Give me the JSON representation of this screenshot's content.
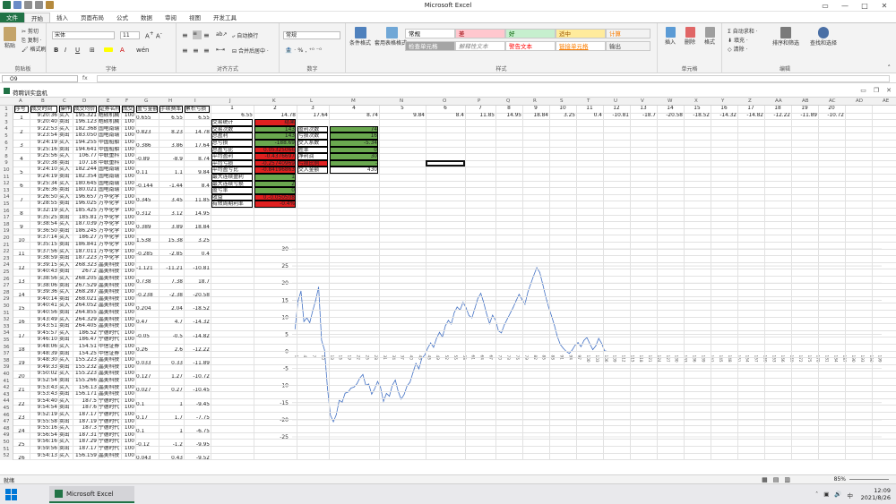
{
  "app": {
    "title": "Microsoft Excel",
    "workbook_title": "荷聘训实盘机"
  },
  "tabs": [
    "文件",
    "开始",
    "插入",
    "页面布局",
    "公式",
    "数据",
    "审阅",
    "视图",
    "开发工具"
  ],
  "ribbon": {
    "clipboard": {
      "group": "剪贴板",
      "paste": "粘贴",
      "cut": "剪切",
      "copy": "复制 ·",
      "format_painter": "格式刷"
    },
    "font": {
      "group": "字体",
      "font_name": "宋体",
      "font_size": "11"
    },
    "alignment": {
      "group": "对齐方式",
      "wrap": "自动换行",
      "merge": "合并后居中 ·"
    },
    "number": {
      "group": "数字",
      "format": "常规"
    },
    "styles": {
      "group": "样式",
      "conditional": "条件格式",
      "table": "套用表格格式 ·",
      "cells": [
        {
          "label": "常规",
          "bg": "#ffffff",
          "fg": "#000000"
        },
        {
          "label": "差",
          "bg": "#ffc7ce",
          "fg": "#9c0006"
        },
        {
          "label": "好",
          "bg": "#c6efce",
          "fg": "#006100"
        },
        {
          "label": "适中",
          "bg": "#ffeb9c",
          "fg": "#9c5700"
        },
        {
          "label": "计算",
          "bg": "#f2f2f2",
          "fg": "#fa7d00"
        },
        {
          "label": "检查单元格",
          "bg": "#a5a5a5",
          "fg": "#ffffff"
        },
        {
          "label": "解释性文本",
          "bg": "#ffffff",
          "fg": "#7f7f7f"
        },
        {
          "label": "警告文本",
          "bg": "#ffffff",
          "fg": "#ff0000"
        },
        {
          "label": "链接单元格",
          "bg": "#ffffff",
          "fg": "#fa7d00"
        },
        {
          "label": "输出",
          "bg": "#f2f2f2",
          "fg": "#3f3f3f"
        }
      ]
    },
    "cells": {
      "group": "单元格",
      "insert": "插入",
      "delete": "删除",
      "format": "格式"
    },
    "editing": {
      "group": "编辑",
      "autosum": "自动求和 ·",
      "fill": "填充 ·",
      "clear": "清除 ·",
      "sort": "排序和筛选",
      "find": "查找和选择"
    }
  },
  "formula_bar": {
    "name_box": "O9",
    "fx": "fx",
    "value": ""
  },
  "sheet": {
    "columns": [
      "A",
      "B",
      "C",
      "D",
      "E",
      "F",
      "G",
      "H",
      "I",
      "J",
      "K",
      "L",
      "M",
      "N",
      "O",
      "P",
      "Q",
      "R",
      "S",
      "T",
      "U",
      "V",
      "W",
      "X",
      "Y",
      "Z",
      "AA",
      "AB",
      "AC",
      "AD",
      "AE"
    ],
    "header_row": [
      "序号",
      "成交时间",
      "操作",
      "成交均价",
      "证券名称",
      "成交数量",
      "盈亏金额",
      "手续费率",
      "累积亏损"
    ],
    "rows": [
      [
        "1",
        "9:20:36",
        "买入",
        "195.321",
        "皓硕机械",
        "100"
      ],
      [
        "",
        "9:20:40",
        "卖出",
        "196.123",
        "皓硕机械",
        "100"
      ],
      [
        "2",
        "9:22:53",
        "买入",
        "182.368",
        "国电南瑞",
        "100"
      ],
      [
        "",
        "9:23:54",
        "卖出",
        "183.050",
        "国电南瑞",
        "100"
      ],
      [
        "3",
        "9:24:19",
        "买入",
        "194.255",
        "中国船舶",
        "100"
      ],
      [
        "",
        "9:25:16",
        "卖出",
        "194.641",
        "中国船舶",
        "100"
      ],
      [
        "4",
        "9:25:56",
        "买入",
        "106.77",
        "中联重科",
        "100"
      ],
      [
        "",
        "9:20:38",
        "卖出",
        "107.18",
        "中联重科",
        "100"
      ],
      [
        "5",
        "9:24:10",
        "买入",
        "182.244",
        "国电南瑞",
        "100"
      ],
      [
        "",
        "9:24:19",
        "卖出",
        "182.354",
        "国电南瑞",
        "100"
      ],
      [
        "6",
        "9:25:34",
        "买入",
        "180.645",
        "国电南瑞",
        "100"
      ],
      [
        "",
        "9:26:36",
        "卖出",
        "180.021",
        "国电南瑞",
        "100"
      ],
      [
        "7",
        "9:26:50",
        "买入",
        "196.657",
        "万华化学",
        "100"
      ],
      [
        "",
        "9:28:55",
        "卖出",
        "196.025",
        "万华化学",
        "100"
      ],
      [
        "8",
        "9:32:19",
        "买入",
        "185.425",
        "万华化学",
        "100"
      ],
      [
        "",
        "9:35:25",
        "卖出",
        "185.81",
        "万华化学",
        "100"
      ],
      [
        "9",
        "9:38:54",
        "买入",
        "187.039",
        "万华化学",
        "100"
      ],
      [
        "",
        "9:36:50",
        "卖出",
        "186.245",
        "万华化学",
        "100"
      ],
      [
        "10",
        "9:37:14",
        "买入",
        "186.27",
        "万华化学",
        "100"
      ],
      [
        "",
        "9:35:15",
        "卖出",
        "186.841",
        "万华化学",
        "100"
      ],
      [
        "11",
        "9:37:56",
        "买入",
        "187.011",
        "万华化学",
        "100"
      ],
      [
        "",
        "9:38:59",
        "卖出",
        "187.223",
        "万华化学",
        "100"
      ],
      [
        "12",
        "9:39:15",
        "买入",
        "268.323",
        "晶美科技",
        "100"
      ],
      [
        "",
        "9:40:43",
        "卖出",
        "267.2",
        "晶美科技",
        "100"
      ],
      [
        "13",
        "9:38:56",
        "买入",
        "268.205",
        "晶美科技",
        "100"
      ],
      [
        "",
        "9:38:06",
        "卖出",
        "267.529",
        "晶美科技",
        "100"
      ],
      [
        "14",
        "9:39:36",
        "买入",
        "268.287",
        "晶美科技",
        "100"
      ],
      [
        "",
        "9:40:14",
        "卖出",
        "268.021",
        "晶美科技",
        "100"
      ],
      [
        "15",
        "9:40:41",
        "买入",
        "264.052",
        "晶美科技",
        "100"
      ],
      [
        "",
        "9:40:56",
        "卖出",
        "264.855",
        "晶美科技",
        "100"
      ],
      [
        "16",
        "9:43:49",
        "买入",
        "264.329",
        "晶美科技",
        "100"
      ],
      [
        "",
        "9:43:51",
        "卖出",
        "264.405",
        "晶美科技",
        "100"
      ],
      [
        "17",
        "9:45:57",
        "买入",
        "186.52",
        "宁德时代",
        "100"
      ],
      [
        "",
        "9:46:10",
        "卖出",
        "186.47",
        "宁德时代",
        "100"
      ],
      [
        "18",
        "9:48:06",
        "买入",
        "154.51",
        "中信证券",
        "100"
      ],
      [
        "",
        "9:48:39",
        "卖出",
        "154.25",
        "中信证券",
        "100"
      ],
      [
        "19",
        "9:48:30",
        "买入",
        "155.223",
        "晶美科技",
        "100"
      ],
      [
        "",
        "9:49:33",
        "卖出",
        "155.232",
        "晶美科技",
        "100"
      ],
      [
        "20",
        "9:50:02",
        "买入",
        "155.223",
        "晶美科技",
        "100"
      ],
      [
        "",
        "9:52:54",
        "卖出",
        "155.266",
        "晶美科技",
        "100"
      ],
      [
        "21",
        "9:53:43",
        "买入",
        "156.13",
        "晶美科技",
        "100"
      ],
      [
        "",
        "9:53:43",
        "卖出",
        "156.171",
        "晶美科技",
        "100"
      ],
      [
        "22",
        "9:54:40",
        "买入",
        "187.5",
        "宁德时代",
        "100"
      ],
      [
        "",
        "9:54:54",
        "卖出",
        "187.6",
        "宁德时代",
        "100"
      ],
      [
        "23",
        "9:52:19",
        "买入",
        "187.17",
        "宁德时代",
        "100"
      ],
      [
        "",
        "9:55:58",
        "卖出",
        "187.19",
        "宁德时代",
        "100"
      ],
      [
        "24",
        "9:55:16",
        "买入",
        "187.3",
        "宁德时代",
        "100"
      ],
      [
        "",
        "9:56:54",
        "卖出",
        "187.31",
        "宁德时代",
        "100"
      ],
      [
        "25",
        "9:56:16",
        "买入",
        "187.29",
        "宁德时代",
        "100"
      ],
      [
        "",
        "9:59:56",
        "卖出",
        "187.17",
        "宁德时代",
        "100"
      ],
      [
        "26",
        "9:54:13",
        "买入",
        "156.159",
        "晶美科技",
        "100"
      ],
      [
        "",
        "9:55:53",
        "卖出",
        "156.202",
        "晶美科技",
        "100"
      ]
    ],
    "pnl": [
      {
        "g": "0.655",
        "h": "6.55",
        "i": "6.55"
      },
      {
        "g": "0.823",
        "h": "8.23",
        "i": "14.78"
      },
      {
        "g": "0.386",
        "h": "3.86",
        "i": "17.64"
      },
      {
        "g": "-0.89",
        "h": "-8.9",
        "i": "8.74"
      },
      {
        "g": "0.11",
        "h": "1.1",
        "i": "9.84"
      },
      {
        "g": "-0.144",
        "h": "-1.44",
        "i": "8.4"
      },
      {
        "g": "0.345",
        "h": "3.45",
        "i": "11.85"
      },
      {
        "g": "0.312",
        "h": "3.12",
        "i": "14.95"
      },
      {
        "g": "0.389",
        "h": "3.89",
        "i": "18.84"
      },
      {
        "g": "1.538",
        "h": "15.38",
        "i": "3.25"
      },
      {
        "g": "-0.285",
        "h": "-2.85",
        "i": "0.4"
      },
      {
        "g": "-1.121",
        "h": "-11.21",
        "i": "-10.81"
      },
      {
        "g": "0.738",
        "h": "7.38",
        "i": "18.7"
      },
      {
        "g": "-0.238",
        "h": "-2.38",
        "i": "-20.58"
      },
      {
        "g": "0.204",
        "h": "2.04",
        "i": "-18.52"
      },
      {
        "g": "0.47",
        "h": "4.7",
        "i": "-14.32"
      },
      {
        "g": "-0.05",
        "h": "-0.5",
        "i": "-14.82"
      },
      {
        "g": "0.26",
        "h": "2.6",
        "i": "-12.22"
      },
      {
        "g": "0.033",
        "h": "0.33",
        "i": "-11.89"
      },
      {
        "g": "0.127",
        "h": "1.27",
        "i": "-10.72"
      },
      {
        "g": "0.027",
        "h": "0.27",
        "i": "-10.45"
      },
      {
        "g": "0.1",
        "h": "1",
        "i": "-9.45"
      },
      {
        "g": "0.17",
        "h": "1.7",
        "i": "-7.75"
      },
      {
        "g": "0.1",
        "h": "1",
        "i": "-6.75"
      },
      {
        "g": "-0.12",
        "h": "-1.2",
        "i": "-9.95"
      },
      {
        "g": "0.043",
        "h": "0.43",
        "i": "-9.52"
      }
    ],
    "top_numbers_row1": [
      "1",
      "2",
      "3",
      "4",
      "5",
      "6",
      "7",
      "8",
      "9",
      "10",
      "11",
      "12",
      "13",
      "14",
      "15",
      "16",
      "17",
      "18",
      "19",
      "20"
    ],
    "top_numbers_row2": [
      "6.55",
      "14.78",
      "17.64",
      "8.74",
      "9.84",
      "8.4",
      "11.85",
      "14.95",
      "18.84",
      "3.25",
      "0.4",
      "-10.81",
      "-18.7",
      "-20.58",
      "-18.52",
      "-14.32",
      "-14.82",
      "-12.22",
      "-11.89",
      "-10.72"
    ],
    "stats": [
      {
        "label": "交易统计",
        "value": "结果",
        "label2": "",
        "value2": ""
      },
      {
        "label": "交易次数",
        "value": "143",
        "label2": "盈利次数",
        "value2": "74"
      },
      {
        "label": "总盈利",
        "value": "143",
        "label2": "亏损次数",
        "value2": "16"
      },
      {
        "label": "总亏损",
        "value": "-188.69",
        "label2": "交入系数",
        "value2": "-5.34"
      },
      {
        "label": "总盈亏比",
        "value": "0.05325066",
        "label2": "胜率",
        "value2": "0"
      },
      {
        "label": "平均盈利",
        "value": "-0.4376697",
        "label2": "净利润",
        "value2": "30"
      },
      {
        "label": "平均亏损",
        "value": "-0.25740969",
        "label2": "亏损比例",
        "value2": "-"
      },
      {
        "label": "平均盈亏比",
        "value": "-0.84196863",
        "label2": "交入金额",
        "value2": "430"
      },
      {
        "label": "最大连续盈利",
        "value": "1",
        "label2": "",
        "value2": ""
      },
      {
        "label": "最大连续亏损",
        "value": "2",
        "label2": "",
        "value2": ""
      },
      {
        "label": "盈亏率",
        "value": "0",
        "label2": "",
        "value2": ""
      },
      {
        "label": "收益",
        "value": "0.-0.050508",
        "label2": "",
        "value2": ""
      },
      {
        "label": "有效周期利率",
        "value": "-0.4%",
        "label2": "",
        "value2": ""
      }
    ],
    "chart_yticks": [
      "30",
      "25",
      "20",
      "15",
      "10",
      "5",
      "0",
      "-5",
      "-10",
      "-15",
      "-20",
      "-25"
    ]
  },
  "chart_data": {
    "type": "line",
    "title": "",
    "xlabel": "",
    "ylabel": "",
    "ylim": [
      -25,
      30
    ],
    "series": [
      {
        "values": [
          6.55,
          14.78,
          17.64,
          8.74,
          9.84,
          8.4,
          11.85,
          14.95,
          18.84,
          3.25,
          0.4,
          -10.81,
          -18.7,
          -20.58,
          -18.52,
          -14.32,
          -14.82,
          -12.22,
          -11.89,
          -10.72,
          -10.45,
          -9.45,
          -7.75,
          -6.75,
          -9.95,
          -9.52,
          -12.5,
          -11.0,
          -8.8,
          -10.5,
          -14.6,
          -12.3,
          -13.1,
          -9.9,
          -8.4,
          -11.7,
          -14.0,
          -12.6,
          -10.1,
          -9.0,
          -6.2,
          -3.5,
          -5.1,
          -2.0,
          -1.1,
          0.9,
          2.5,
          1.2,
          3.8,
          5.6,
          4.2,
          7.5,
          9.1,
          8.0,
          11.3,
          13.0,
          12.1,
          14.4,
          12.8,
          10.5,
          9.8,
          12.6,
          15.5,
          17.0,
          14.3,
          11.0,
          8.1,
          10.6,
          9.2,
          6.0,
          5.4,
          7.8,
          9.5,
          11.2,
          12.9,
          14.8,
          16.7,
          15.2,
          13.8,
          17.4,
          19.9,
          22.3,
          24.5,
          23.1,
          19.8,
          16.2,
          13.0,
          10.4,
          7.6,
          4.3,
          2.0,
          0.9,
          0.0,
          -0.6,
          0.4,
          1.8,
          2.6,
          1.4,
          3.2,
          4.1,
          2.2,
          0.5,
          1.6,
          3.8,
          2.4,
          0.2,
          0.0,
          0.0,
          0.0
        ]
      }
    ]
  },
  "status": {
    "ready": "就绪",
    "zoom": "85%"
  },
  "taskbar": {
    "app": "Microsoft Excel",
    "time": "12:09",
    "date": "2021/8/26"
  }
}
